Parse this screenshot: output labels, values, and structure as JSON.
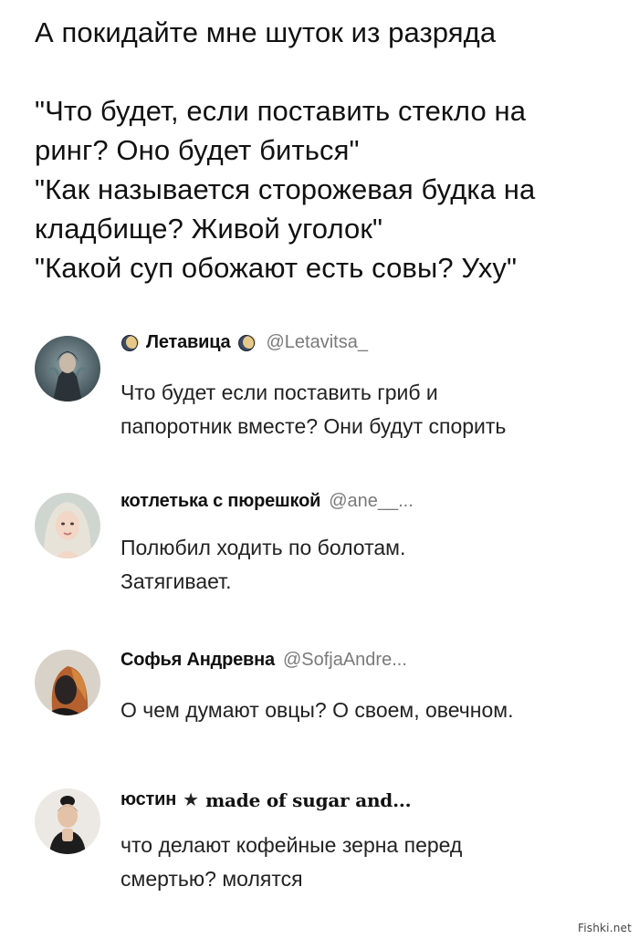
{
  "post": {
    "lines": [
      "А покидайте мне шуток из разряда",
      "",
      "\"Что будет, если поставить стекло на",
      "ринг? Оно будет биться\"",
      "\"Как называется сторожевая будка на",
      "кладбище? Живой уголок\"",
      "\"Какой суп обожают есть совы? Уху\""
    ]
  },
  "replies": [
    {
      "name": "Летавица",
      "handle": "@Letavitsa_",
      "icon": "moon-icon",
      "lines": [
        "Что будет если поставить гриб и",
        "папоротник вместе? Они будут спорить"
      ]
    },
    {
      "name": "котлетька с пюрешкой",
      "handle": "@ane__...",
      "lines": [
        "Полюбил ходить по болотам.",
        "Затягивает."
      ]
    },
    {
      "name": "Софья Андревна",
      "handle": "@SofjaAndre...",
      "lines": [
        "О чем думают овцы? О своем, овечном."
      ]
    },
    {
      "name_part1": "юстин",
      "name_icon": "star-icon",
      "name_part2": "made of sugar and...",
      "lines": [
        "что делают кофейные зерна перед",
        "смертью? молятся"
      ]
    }
  ],
  "watermark": "Fishki.net",
  "colors": {
    "text": "#111111",
    "handle": "#7a7a7a",
    "background": "#ffffff"
  }
}
